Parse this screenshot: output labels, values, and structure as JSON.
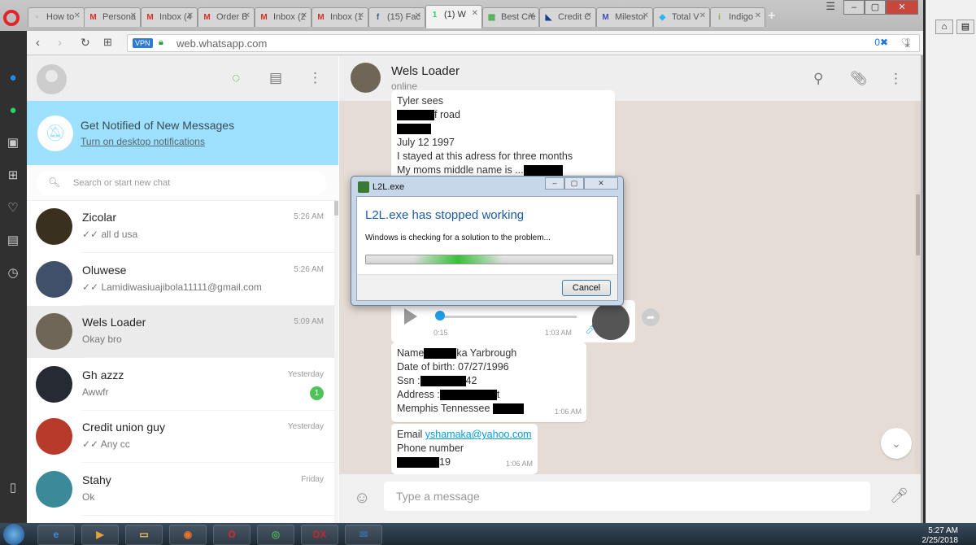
{
  "browser": {
    "tabs": [
      {
        "label": "How to",
        "icon": "doc-icon",
        "color": "#999999",
        "glyph": "▫"
      },
      {
        "label": "Persona",
        "icon": "gmail-icon",
        "color": "#d93025",
        "glyph": "M"
      },
      {
        "label": "Inbox (4",
        "icon": "gmail-icon",
        "color": "#d93025",
        "glyph": "M"
      },
      {
        "label": "Order B",
        "icon": "gmail-icon",
        "color": "#d93025",
        "glyph": "M"
      },
      {
        "label": "Inbox (2",
        "icon": "gmail-icon",
        "color": "#d93025",
        "glyph": "M"
      },
      {
        "label": "Inbox (1",
        "icon": "gmail-icon",
        "color": "#d93025",
        "glyph": "M"
      },
      {
        "label": "(15) Fac",
        "icon": "facebook-icon",
        "color": "#3b5998",
        "glyph": "f"
      },
      {
        "label": "(1) W",
        "icon": "whatsapp-icon",
        "color": "#25d366",
        "glyph": "1"
      },
      {
        "label": "Best Cre",
        "icon": "site-icon",
        "color": "#4caf50",
        "glyph": "▦"
      },
      {
        "label": "Credit C",
        "icon": "site-icon",
        "color": "#1a3c8a",
        "glyph": "◣"
      },
      {
        "label": "Milestor",
        "icon": "site-icon",
        "color": "#3f51b5",
        "glyph": "M"
      },
      {
        "label": "Total V",
        "icon": "site-icon",
        "color": "#29b6f6",
        "glyph": "◆"
      },
      {
        "label": "Indigo",
        "icon": "site-icon",
        "color": "#7cb342",
        "glyph": "i"
      }
    ],
    "new_tab": "+",
    "vpn": "VPN",
    "url": "web.whatsapp.com",
    "adblock_count": "0"
  },
  "whatsapp": {
    "notification": {
      "title": "Get Notified of New Messages",
      "link": "Turn on desktop notifications"
    },
    "search_placeholder": "Search or start new chat",
    "chats": [
      {
        "name": "Zicolar",
        "last": "✓✓ all d usa",
        "time": "5:26 AM",
        "unread": "",
        "avatar": "#3a3020"
      },
      {
        "name": "Oluwese",
        "last": "✓✓ Lamidiwasiuajibola11111@gmail.com",
        "time": "5:26 AM",
        "unread": "",
        "avatar": "#40506a"
      },
      {
        "name": "Wels Loader",
        "last": "Okay bro",
        "time": "5:09 AM",
        "unread": "",
        "avatar": "#6f6658"
      },
      {
        "name": "Gh azzz",
        "last": "Awwfr",
        "time": "Yesterday",
        "unread": "1",
        "avatar": "#252a33"
      },
      {
        "name": "Credit union guy",
        "last": "✓✓ Any cc",
        "time": "Yesterday",
        "unread": "",
        "avatar": "#b83a2a"
      },
      {
        "name": "Stahy",
        "last": "Ok",
        "time": "Friday",
        "unread": "",
        "avatar": "#3a8a9a"
      }
    ],
    "contact": {
      "name": "Wels Loader",
      "status": "online"
    },
    "messages": {
      "m1_l1": "Tyler sees",
      "m1_l2": "f road",
      "m1_l3": "July 12 1997",
      "m1_l4": "I stayed at this adress for three months",
      "m1_l5": "My moms middle name is ...",
      "voice_duration": "0:15",
      "voice_time": "1:03 AM",
      "m2_l1a": "Name",
      "m2_l1b": "ka Yarbrough",
      "m2_l2": "Date of birth: 07/27/1996",
      "m2_l3a": "Ssn :",
      "m2_l3b": "42",
      "m2_l4a": "Address :",
      "m2_l4b": "t",
      "m2_l5": "Memphis Tennessee",
      "m2_time": "1:06 AM",
      "m3_l1a": "Email",
      "m3_l1b": "yshamaka@yahoo.com",
      "m3_l2": "Phone number",
      "m3_l3": "19",
      "m3_time": "1:06 AM"
    },
    "input_placeholder": "Type a message"
  },
  "dialog": {
    "title": "L2L.exe",
    "heading": "L2L.exe has stopped working",
    "message": "Windows is checking for a solution to the problem...",
    "cancel": "Cancel"
  },
  "taskbar": {
    "apps": [
      "e",
      "▶",
      "▭",
      "◉",
      "O",
      "◎",
      "DX",
      "✉"
    ],
    "time": "5:27 AM",
    "date": "2/25/2018"
  }
}
